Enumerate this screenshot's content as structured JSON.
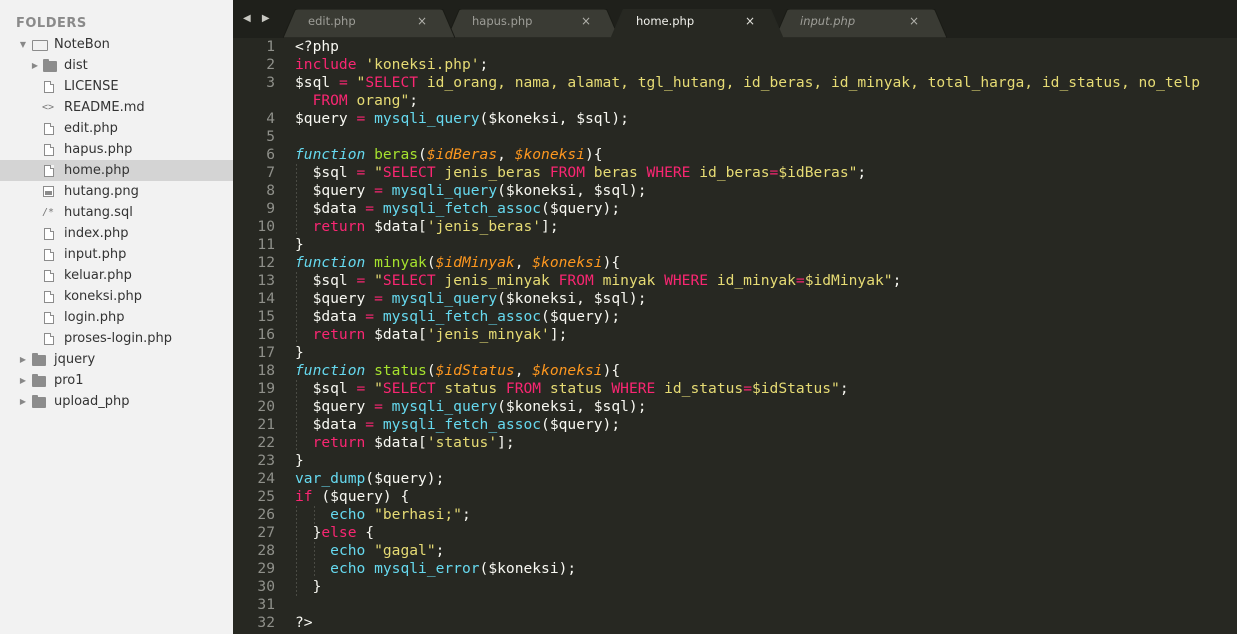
{
  "sidebar": {
    "header": "FOLDERS",
    "items": [
      {
        "label": "NoteBon",
        "kind": "folder-open",
        "indent": 0,
        "arrow": "down",
        "icon": "folder-open-icon"
      },
      {
        "label": "dist",
        "kind": "folder",
        "indent": 1,
        "arrow": "right",
        "icon": "folder-icon"
      },
      {
        "label": "LICENSE",
        "kind": "file",
        "indent": 1,
        "icon": "file-icon"
      },
      {
        "label": "README.md",
        "kind": "glyph",
        "indent": 1,
        "icon": "markup-icon",
        "glyph": "<>"
      },
      {
        "label": "edit.php",
        "kind": "file",
        "indent": 1,
        "icon": "file-icon"
      },
      {
        "label": "hapus.php",
        "kind": "file",
        "indent": 1,
        "icon": "file-icon"
      },
      {
        "label": "home.php",
        "kind": "file",
        "indent": 1,
        "icon": "file-icon",
        "selected": true
      },
      {
        "label": "hutang.png",
        "kind": "image",
        "indent": 1,
        "icon": "image-icon"
      },
      {
        "label": "hutang.sql",
        "kind": "glyph",
        "indent": 1,
        "icon": "comment-icon",
        "glyph": "/*"
      },
      {
        "label": "index.php",
        "kind": "file",
        "indent": 1,
        "icon": "file-icon"
      },
      {
        "label": "input.php",
        "kind": "file",
        "indent": 1,
        "icon": "file-icon"
      },
      {
        "label": "keluar.php",
        "kind": "file",
        "indent": 1,
        "icon": "file-icon"
      },
      {
        "label": "koneksi.php",
        "kind": "file",
        "indent": 1,
        "icon": "file-icon"
      },
      {
        "label": "login.php",
        "kind": "file",
        "indent": 1,
        "icon": "file-icon"
      },
      {
        "label": "proses-login.php",
        "kind": "file",
        "indent": 1,
        "icon": "file-icon"
      },
      {
        "label": "jquery",
        "kind": "folder",
        "indent": 0,
        "arrow": "right",
        "icon": "folder-icon"
      },
      {
        "label": "pro1",
        "kind": "folder",
        "indent": 0,
        "arrow": "right",
        "icon": "folder-icon"
      },
      {
        "label": "upload_php",
        "kind": "folder",
        "indent": 0,
        "arrow": "right",
        "icon": "folder-icon"
      }
    ]
  },
  "tabbar": {
    "nav": "◀ ▶",
    "close_glyph": "×",
    "tabs": [
      {
        "label": "edit.php",
        "active": false,
        "italic": false
      },
      {
        "label": "hapus.php",
        "active": false,
        "italic": false
      },
      {
        "label": "home.php",
        "active": true,
        "italic": false
      },
      {
        "label": "input.php",
        "active": false,
        "italic": true
      }
    ]
  },
  "editor": {
    "lines": [
      {
        "n": "1",
        "tokens": [
          [
            "w",
            "<?php"
          ]
        ]
      },
      {
        "n": "2",
        "tokens": [
          [
            "p",
            "include"
          ],
          [
            "w",
            " "
          ],
          [
            "y",
            "'koneksi.php'"
          ],
          [
            "w",
            ";"
          ]
        ]
      },
      {
        "n": "3",
        "tokens": [
          [
            "w",
            "$sql "
          ],
          [
            "p",
            "="
          ],
          [
            "w",
            " "
          ],
          [
            "y",
            "\""
          ],
          [
            "p",
            "SELECT"
          ],
          [
            "y",
            " id_orang, nama, alamat, tgl_hutang, id_beras, id_minyak, total_harga, id_status, no_telp"
          ]
        ]
      },
      {
        "n": "",
        "tokens": [
          [
            "y",
            "  "
          ],
          [
            "p",
            "FROM"
          ],
          [
            "y",
            " orang\""
          ],
          [
            "w",
            ";"
          ]
        ]
      },
      {
        "n": "4",
        "tokens": [
          [
            "w",
            "$query "
          ],
          [
            "p",
            "="
          ],
          [
            "w",
            " "
          ],
          [
            "b",
            "mysqli_query"
          ],
          [
            "w",
            "($koneksi, $sql);"
          ]
        ]
      },
      {
        "n": "5",
        "tokens": []
      },
      {
        "n": "6",
        "tokens": [
          [
            "bi",
            "function"
          ],
          [
            "w",
            " "
          ],
          [
            "g",
            "beras"
          ],
          [
            "w",
            "("
          ],
          [
            "o",
            "$idBeras"
          ],
          [
            "w",
            ", "
          ],
          [
            "o",
            "$koneksi"
          ],
          [
            "w",
            "){"
          ]
        ]
      },
      {
        "n": "7",
        "tokens": [
          [
            "w",
            "  $sql "
          ],
          [
            "p",
            "="
          ],
          [
            "w",
            " "
          ],
          [
            "y",
            "\""
          ],
          [
            "p",
            "SELECT"
          ],
          [
            "y",
            " jenis_beras "
          ],
          [
            "p",
            "FROM"
          ],
          [
            "y",
            " beras "
          ],
          [
            "p",
            "WHERE"
          ],
          [
            "y",
            " id_beras"
          ],
          [
            "p",
            "="
          ],
          [
            "y",
            "$idBeras\""
          ],
          [
            "w",
            ";"
          ]
        ]
      },
      {
        "n": "8",
        "tokens": [
          [
            "w",
            "  $query "
          ],
          [
            "p",
            "="
          ],
          [
            "w",
            " "
          ],
          [
            "b",
            "mysqli_query"
          ],
          [
            "w",
            "($koneksi, $sql);"
          ]
        ]
      },
      {
        "n": "9",
        "tokens": [
          [
            "w",
            "  $data "
          ],
          [
            "p",
            "="
          ],
          [
            "w",
            " "
          ],
          [
            "b",
            "mysqli_fetch_assoc"
          ],
          [
            "w",
            "($query);"
          ]
        ]
      },
      {
        "n": "10",
        "tokens": [
          [
            "w",
            "  "
          ],
          [
            "p",
            "return"
          ],
          [
            "w",
            " $data["
          ],
          [
            "y",
            "'jenis_beras'"
          ],
          [
            "w",
            "];"
          ]
        ]
      },
      {
        "n": "11",
        "tokens": [
          [
            "w",
            "}"
          ]
        ]
      },
      {
        "n": "12",
        "tokens": [
          [
            "bi",
            "function"
          ],
          [
            "w",
            " "
          ],
          [
            "g",
            "minyak"
          ],
          [
            "w",
            "("
          ],
          [
            "o",
            "$idMinyak"
          ],
          [
            "w",
            ", "
          ],
          [
            "o",
            "$koneksi"
          ],
          [
            "w",
            "){"
          ]
        ]
      },
      {
        "n": "13",
        "tokens": [
          [
            "w",
            "  $sql "
          ],
          [
            "p",
            "="
          ],
          [
            "w",
            " "
          ],
          [
            "y",
            "\""
          ],
          [
            "p",
            "SELECT"
          ],
          [
            "y",
            " jenis_minyak "
          ],
          [
            "p",
            "FROM"
          ],
          [
            "y",
            " minyak "
          ],
          [
            "p",
            "WHERE"
          ],
          [
            "y",
            " id_minyak"
          ],
          [
            "p",
            "="
          ],
          [
            "y",
            "$idMinyak\""
          ],
          [
            "w",
            ";"
          ]
        ]
      },
      {
        "n": "14",
        "tokens": [
          [
            "w",
            "  $query "
          ],
          [
            "p",
            "="
          ],
          [
            "w",
            " "
          ],
          [
            "b",
            "mysqli_query"
          ],
          [
            "w",
            "($koneksi, $sql);"
          ]
        ]
      },
      {
        "n": "15",
        "tokens": [
          [
            "w",
            "  $data "
          ],
          [
            "p",
            "="
          ],
          [
            "w",
            " "
          ],
          [
            "b",
            "mysqli_fetch_assoc"
          ],
          [
            "w",
            "($query);"
          ]
        ]
      },
      {
        "n": "16",
        "tokens": [
          [
            "w",
            "  "
          ],
          [
            "p",
            "return"
          ],
          [
            "w",
            " $data["
          ],
          [
            "y",
            "'jenis_minyak'"
          ],
          [
            "w",
            "];"
          ]
        ]
      },
      {
        "n": "17",
        "tokens": [
          [
            "w",
            "}"
          ]
        ]
      },
      {
        "n": "18",
        "tokens": [
          [
            "bi",
            "function"
          ],
          [
            "w",
            " "
          ],
          [
            "g",
            "status"
          ],
          [
            "w",
            "("
          ],
          [
            "o",
            "$idStatus"
          ],
          [
            "w",
            ", "
          ],
          [
            "o",
            "$koneksi"
          ],
          [
            "w",
            "){"
          ]
        ]
      },
      {
        "n": "19",
        "tokens": [
          [
            "w",
            "  $sql "
          ],
          [
            "p",
            "="
          ],
          [
            "w",
            " "
          ],
          [
            "y",
            "\""
          ],
          [
            "p",
            "SELECT"
          ],
          [
            "y",
            " status "
          ],
          [
            "p",
            "FROM"
          ],
          [
            "y",
            " status "
          ],
          [
            "p",
            "WHERE"
          ],
          [
            "y",
            " id_status"
          ],
          [
            "p",
            "="
          ],
          [
            "y",
            "$idStatus\""
          ],
          [
            "w",
            ";"
          ]
        ]
      },
      {
        "n": "20",
        "tokens": [
          [
            "w",
            "  $query "
          ],
          [
            "p",
            "="
          ],
          [
            "w",
            " "
          ],
          [
            "b",
            "mysqli_query"
          ],
          [
            "w",
            "($koneksi, $sql);"
          ]
        ]
      },
      {
        "n": "21",
        "tokens": [
          [
            "w",
            "  $data "
          ],
          [
            "p",
            "="
          ],
          [
            "w",
            " "
          ],
          [
            "b",
            "mysqli_fetch_assoc"
          ],
          [
            "w",
            "($query);"
          ]
        ]
      },
      {
        "n": "22",
        "tokens": [
          [
            "w",
            "  "
          ],
          [
            "p",
            "return"
          ],
          [
            "w",
            " $data["
          ],
          [
            "y",
            "'status'"
          ],
          [
            "w",
            "];"
          ]
        ]
      },
      {
        "n": "23",
        "tokens": [
          [
            "w",
            "}"
          ]
        ]
      },
      {
        "n": "24",
        "tokens": [
          [
            "b",
            "var_dump"
          ],
          [
            "w",
            "($query);"
          ]
        ]
      },
      {
        "n": "25",
        "tokens": [
          [
            "p",
            "if"
          ],
          [
            "w",
            " ($query) {"
          ]
        ]
      },
      {
        "n": "26",
        "tokens": [
          [
            "w",
            "    "
          ],
          [
            "b",
            "echo"
          ],
          [
            "w",
            " "
          ],
          [
            "y",
            "\"berhasi;\""
          ],
          [
            "w",
            ";"
          ]
        ]
      },
      {
        "n": "27",
        "tokens": [
          [
            "w",
            "  }"
          ],
          [
            "p",
            "else"
          ],
          [
            "w",
            " {"
          ]
        ]
      },
      {
        "n": "28",
        "tokens": [
          [
            "w",
            "    "
          ],
          [
            "b",
            "echo"
          ],
          [
            "w",
            " "
          ],
          [
            "y",
            "\"gagal\""
          ],
          [
            "w",
            ";"
          ]
        ]
      },
      {
        "n": "29",
        "tokens": [
          [
            "w",
            "    "
          ],
          [
            "b",
            "echo"
          ],
          [
            "w",
            " "
          ],
          [
            "b",
            "mysqli_error"
          ],
          [
            "w",
            "($koneksi);"
          ]
        ]
      },
      {
        "n": "30",
        "tokens": [
          [
            "w",
            "  }"
          ]
        ]
      },
      {
        "n": "31",
        "tokens": []
      },
      {
        "n": "32",
        "tokens": [
          [
            "w",
            "?>"
          ]
        ]
      }
    ]
  },
  "colors": {
    "editor_bg": "#272822",
    "sidebar_bg": "#f2f2f2",
    "keyword": "#f92672",
    "string": "#e6db74",
    "builtin": "#66d9ef",
    "function_name": "#a6e22e",
    "parameter": "#fd971f",
    "text": "#f8f8f2",
    "line_number": "#8f908a"
  }
}
